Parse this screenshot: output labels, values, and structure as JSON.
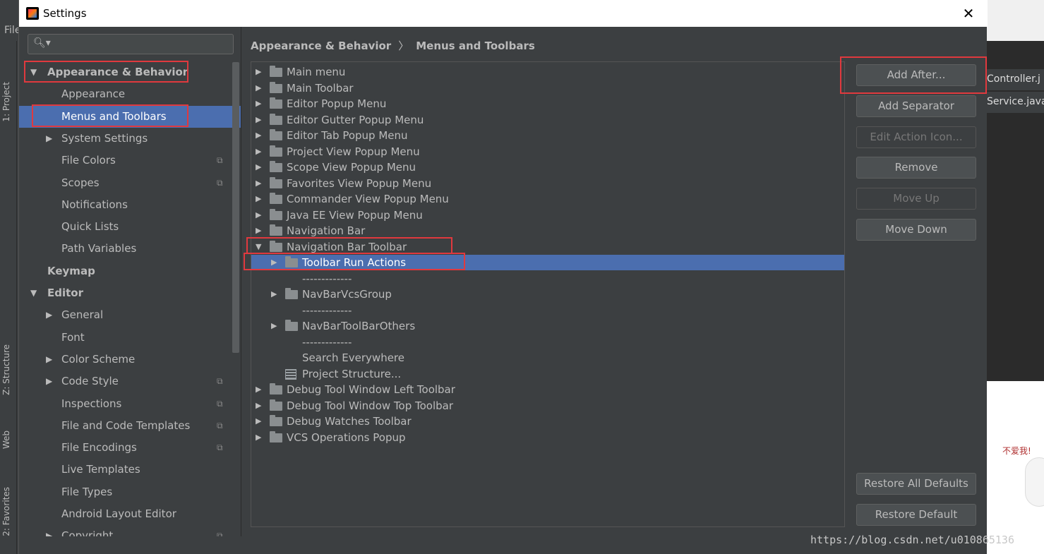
{
  "window": {
    "title": "Settings",
    "close_glyph": "✕"
  },
  "ide": {
    "menu_file": "File",
    "side_tabs": [
      "1: Project",
      "Z: Structure",
      "Web",
      "2: Favorites"
    ],
    "editor_tabs": [
      "Controller.j",
      "Service.java"
    ],
    "sticker_text": "不爱我!",
    "watermark": "https://blog.csdn.net/u010865136"
  },
  "search": {
    "placeholder": "",
    "icon": "search-icon"
  },
  "sidebar": {
    "items": [
      {
        "label": "Appearance & Behavior",
        "level": 0,
        "arrow": "▼",
        "bold": true
      },
      {
        "label": "Appearance",
        "level": 1
      },
      {
        "label": "Menus and Toolbars",
        "level": 1,
        "selected": true
      },
      {
        "label": "System Settings",
        "level": 1,
        "arrow": "▶"
      },
      {
        "label": "File Colors",
        "level": 1,
        "copy": true
      },
      {
        "label": "Scopes",
        "level": 1,
        "copy": true
      },
      {
        "label": "Notifications",
        "level": 1
      },
      {
        "label": "Quick Lists",
        "level": 1
      },
      {
        "label": "Path Variables",
        "level": 1
      },
      {
        "label": "Keymap",
        "level": 0,
        "bold": true
      },
      {
        "label": "Editor",
        "level": 0,
        "arrow": "▼",
        "bold": true
      },
      {
        "label": "General",
        "level": 1,
        "arrow": "▶"
      },
      {
        "label": "Font",
        "level": 1
      },
      {
        "label": "Color Scheme",
        "level": 1,
        "arrow": "▶"
      },
      {
        "label": "Code Style",
        "level": 1,
        "arrow": "▶",
        "copy": true
      },
      {
        "label": "Inspections",
        "level": 1,
        "copy": true
      },
      {
        "label": "File and Code Templates",
        "level": 1,
        "copy": true
      },
      {
        "label": "File Encodings",
        "level": 1,
        "copy": true
      },
      {
        "label": "Live Templates",
        "level": 1
      },
      {
        "label": "File Types",
        "level": 1
      },
      {
        "label": "Android Layout Editor",
        "level": 1
      },
      {
        "label": "Copyright",
        "level": 1,
        "arrow": "▶",
        "copy": true
      }
    ]
  },
  "breadcrumb": {
    "parent": "Appearance & Behavior",
    "separator": "〉",
    "current": "Menus and Toolbars"
  },
  "tree": {
    "rows": [
      {
        "label": "Main menu",
        "indent": 0,
        "tri": "▶",
        "folder": true
      },
      {
        "label": "Main Toolbar",
        "indent": 0,
        "tri": "▶",
        "folder": true
      },
      {
        "label": "Editor Popup Menu",
        "indent": 0,
        "tri": "▶",
        "folder": true
      },
      {
        "label": "Editor Gutter Popup Menu",
        "indent": 0,
        "tri": "▶",
        "folder": true
      },
      {
        "label": "Editor Tab Popup Menu",
        "indent": 0,
        "tri": "▶",
        "folder": true
      },
      {
        "label": "Project View Popup Menu",
        "indent": 0,
        "tri": "▶",
        "folder": true
      },
      {
        "label": "Scope View Popup Menu",
        "indent": 0,
        "tri": "▶",
        "folder": true
      },
      {
        "label": "Favorites View Popup Menu",
        "indent": 0,
        "tri": "▶",
        "folder": true
      },
      {
        "label": "Commander View Popup Menu",
        "indent": 0,
        "tri": "▶",
        "folder": true
      },
      {
        "label": "Java EE View Popup Menu",
        "indent": 0,
        "tri": "▶",
        "folder": true
      },
      {
        "label": "Navigation Bar",
        "indent": 0,
        "tri": "▶",
        "folder": true
      },
      {
        "label": "Navigation Bar Toolbar",
        "indent": 0,
        "tri": "▼",
        "folder": true
      },
      {
        "label": "Toolbar Run Actions",
        "indent": 1,
        "tri": "▶",
        "folder": true,
        "selected": true
      },
      {
        "label": "-------------",
        "indent": 1
      },
      {
        "label": "NavBarVcsGroup",
        "indent": 1,
        "tri": "▶",
        "folder": true
      },
      {
        "label": "-------------",
        "indent": 1
      },
      {
        "label": "NavBarToolBarOthers",
        "indent": 1,
        "tri": "▶",
        "folder": true
      },
      {
        "label": "-------------",
        "indent": 1
      },
      {
        "label": "Search Everywhere",
        "indent": 1
      },
      {
        "label": "Project Structure...",
        "indent": 1,
        "ps_icon": true
      },
      {
        "label": "Debug Tool Window Left Toolbar",
        "indent": 0,
        "tri": "▶",
        "folder": true
      },
      {
        "label": "Debug Tool Window Top Toolbar",
        "indent": 0,
        "tri": "▶",
        "folder": true
      },
      {
        "label": "Debug Watches Toolbar",
        "indent": 0,
        "tri": "▶",
        "folder": true
      },
      {
        "label": "VCS Operations Popup",
        "indent": 0,
        "tri": "▶",
        "folder": true
      }
    ]
  },
  "buttons": {
    "add_after": "Add After...",
    "add_separator": "Add Separator",
    "edit_action_icon": "Edit Action Icon...",
    "remove": "Remove",
    "move_up": "Move Up",
    "move_down": "Move Down",
    "restore_all_defaults": "Restore All Defaults",
    "restore_default": "Restore Default"
  },
  "colors": {
    "selection": "#4b6eaf",
    "highlight_box": "#e0393e",
    "panel": "#3c3f41"
  }
}
